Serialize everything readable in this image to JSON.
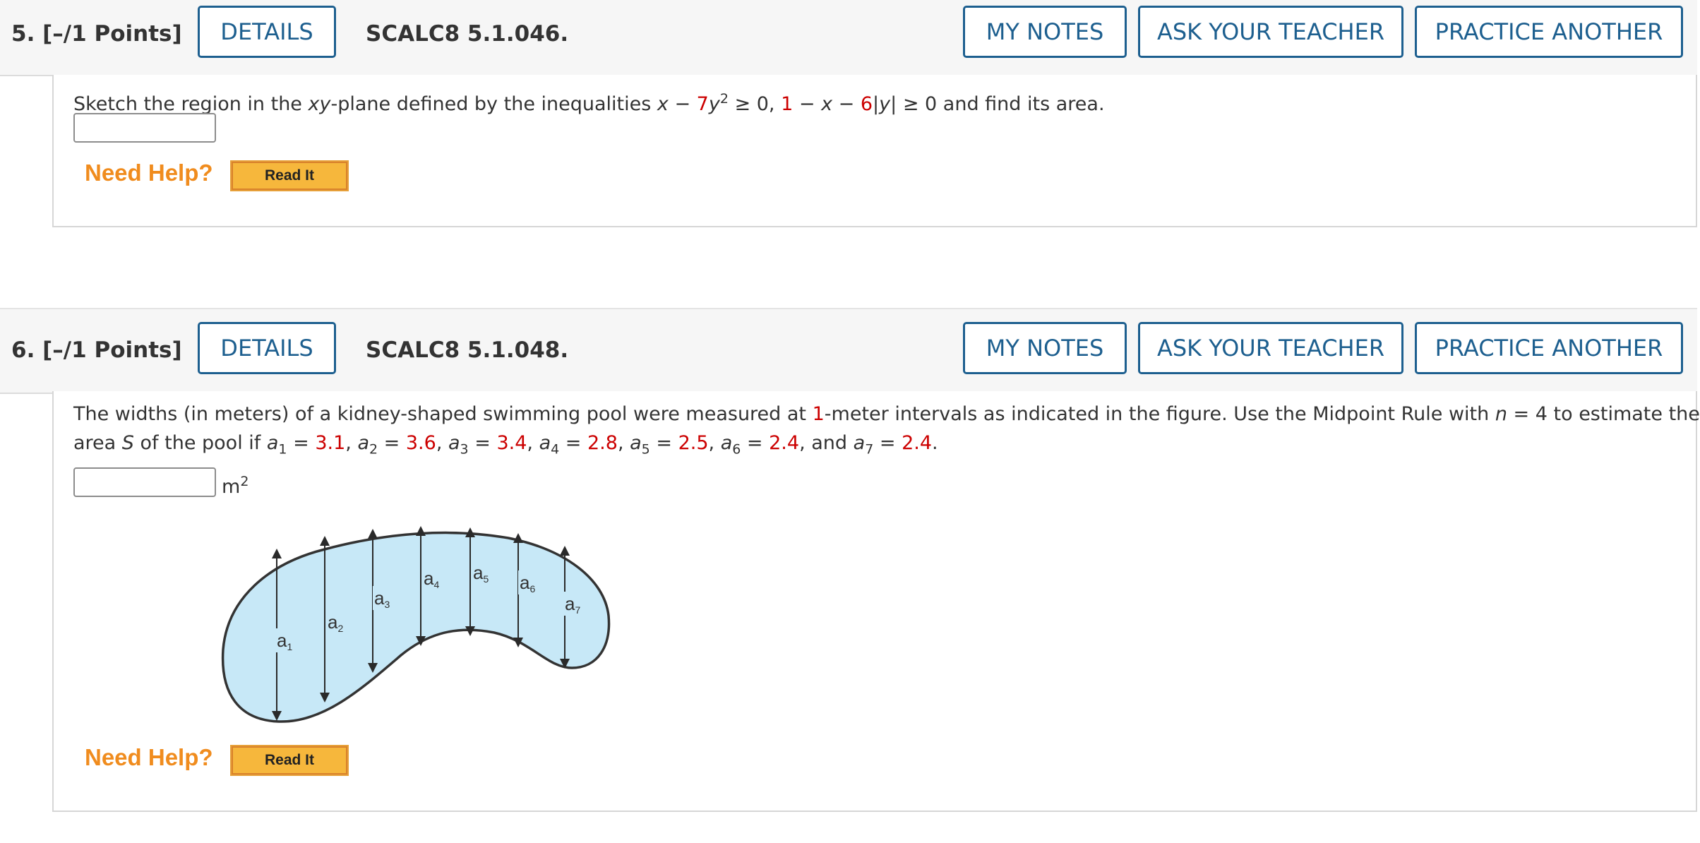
{
  "q5": {
    "number_label": "5.  [–/1 Points]",
    "details_label": "DETAILS",
    "code": "SCALC8 5.1.046.",
    "my_notes_label": "MY NOTES",
    "ask_teacher_label": "ASK YOUR TEACHER",
    "practice_label": "PRACTICE ANOTHER",
    "prompt_pre": "Sketch the region in the ",
    "prompt_xy": "xy",
    "prompt_mid": "-plane defined by the inequalities  ",
    "ineq_x1": "x",
    "ineq_minus1": " − ",
    "ineq_7": "7",
    "ineq_y1": "y",
    "ineq_sq": "2",
    "ineq_ge1": " ≥ 0, ",
    "ineq_1": "1",
    "ineq_minus2": " − ",
    "ineq_x2": "x",
    "ineq_minus3": " − ",
    "ineq_6": "6",
    "ineq_abs_l": "|",
    "ineq_y2": "y",
    "ineq_abs_r": "|",
    "ineq_ge2": " ≥ 0 ",
    "prompt_end": " and find its area.",
    "answer_value": "",
    "need_help": "Need Help?",
    "read_it": "Read It"
  },
  "q6": {
    "number_label": "6.  [–/1 Points]",
    "details_label": "DETAILS",
    "code": "SCALC8 5.1.048.",
    "my_notes_label": "MY NOTES",
    "ask_teacher_label": "ASK YOUR TEACHER",
    "practice_label": "PRACTICE ANOTHER",
    "line1_pre": "The widths (in meters) of a kidney-shaped swimming pool were measured at ",
    "line1_interval": "1",
    "line1_mid": "-meter intervals as indicated in the figure. Use the Midpoint Rule with ",
    "line1_n": "n",
    "line1_end": " = 4 to estimate the",
    "line2_pre": "area ",
    "line2_S": "S",
    "line2_mid": " of the pool if ",
    "widths": [
      {
        "name": "a",
        "sub": "1",
        "value": "3.1"
      },
      {
        "name": "a",
        "sub": "2",
        "value": "3.6"
      },
      {
        "name": "a",
        "sub": "3",
        "value": "3.4"
      },
      {
        "name": "a",
        "sub": "4",
        "value": "2.8"
      },
      {
        "name": "a",
        "sub": "5",
        "value": "2.5"
      },
      {
        "name": "a",
        "sub": "6",
        "value": "2.4"
      },
      {
        "name": "a",
        "sub": "7",
        "value": "2.4"
      }
    ],
    "and_word": "and",
    "unit": "m",
    "unit_exp": "2",
    "answer_value": "",
    "figure_labels": [
      "a",
      "a",
      "a",
      "a",
      "a",
      "a",
      "a"
    ],
    "figure_subs": [
      "1",
      "2",
      "3",
      "4",
      "5",
      "6",
      "7"
    ],
    "pool_fill": "#c7e8f7",
    "need_help": "Need Help?",
    "read_it": "Read It"
  }
}
